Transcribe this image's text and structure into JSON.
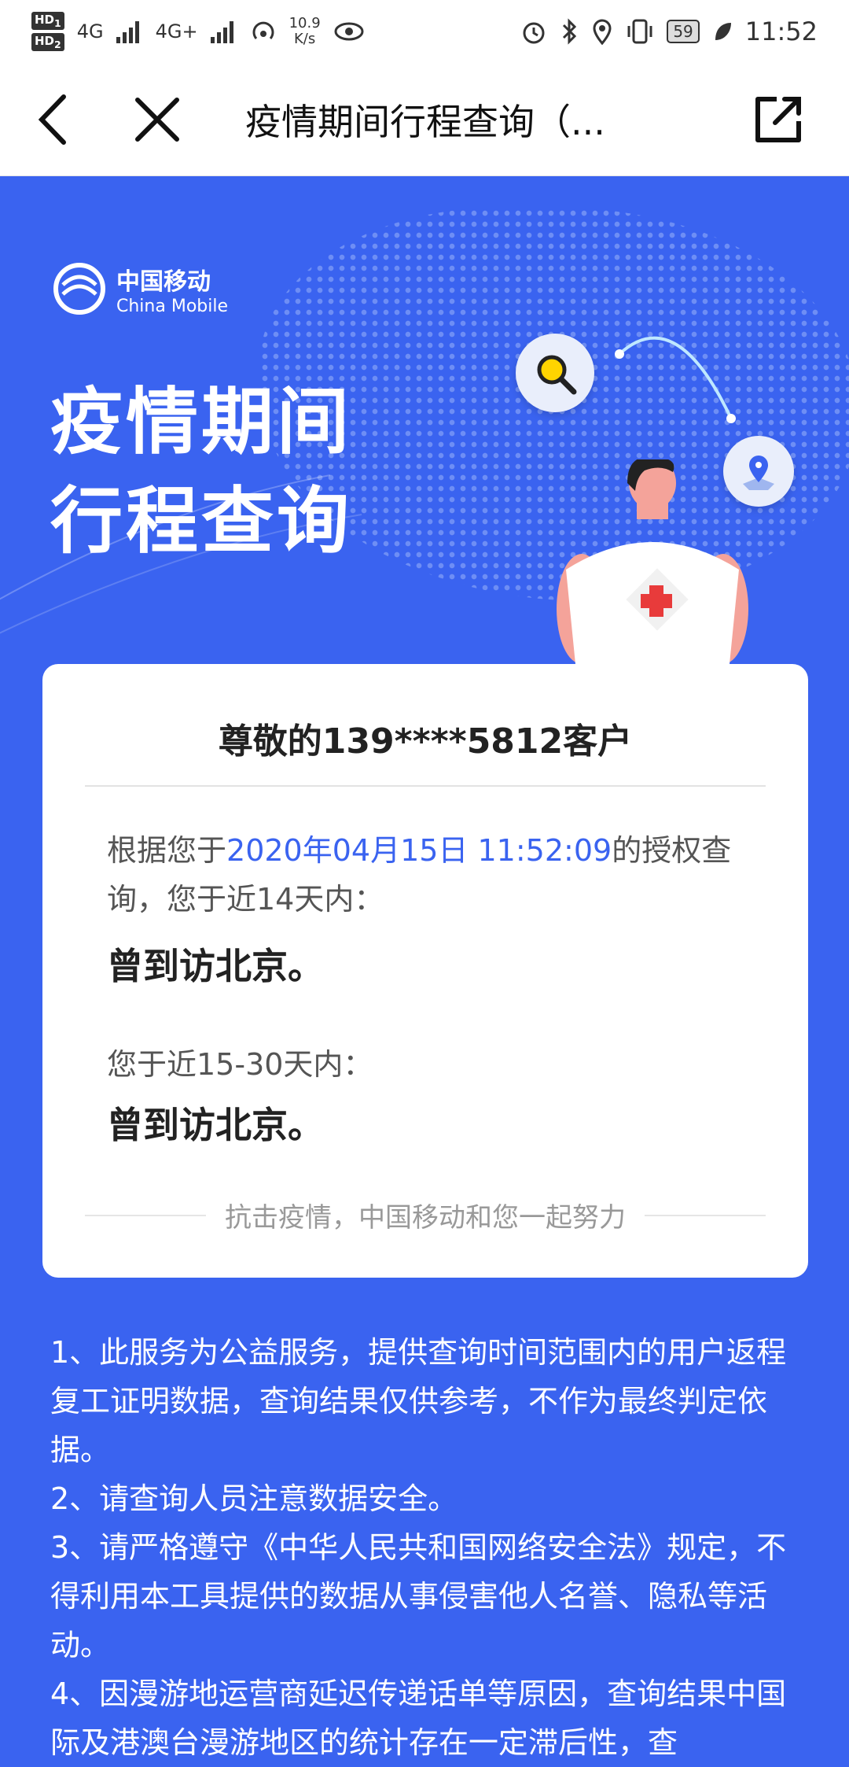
{
  "status_bar": {
    "hd1": "HD",
    "hd2": "HD",
    "sim1": "1",
    "sim2": "2",
    "net1": "4G",
    "net2": "4G+",
    "speed_value": "10.9",
    "speed_unit": "K/s",
    "battery": "59",
    "time": "11:52"
  },
  "nav": {
    "title": "疫情期间行程查询（..."
  },
  "hero": {
    "logo_cn": "中国移动",
    "logo_en": "China Mobile",
    "title_line1": "疫情期间",
    "title_line2": "行程查询"
  },
  "card": {
    "greeting": "尊敬的139****5812客户",
    "intro_prefix": "根据您于",
    "intro_datetime": "2020年04月15日 11:52:09",
    "intro_suffix": "的授权查询，您于近14天内：",
    "result_14": "曾到访北京。",
    "label_30": "您于近15-30天内：",
    "result_30": "曾到访北京。",
    "footer": "抗击疫情，中国移动和您一起努力"
  },
  "notes": [
    "1、此服务为公益服务，提供查询时间范围内的用户返程复工证明数据，查询结果仅供参考，不作为最终判定依据。",
    "2、请查询人员注意数据安全。",
    "3、请严格遵守《中华人民共和国网络安全法》规定，不 得利用本工具提供的数据从事侵害他人名誉、隐私等活动。",
    "4、因漫游地运营商延迟传递话单等原因，查询结果中国际及港澳台漫游地区的统计存在一定滞后性，查"
  ],
  "colors": {
    "accent": "#3a63f0",
    "highlight_text": "#3a63f0"
  },
  "icons": {
    "back": "chevron-left-icon",
    "close": "close-icon",
    "share": "share-external-icon",
    "search": "search-magnifier-icon",
    "location": "location-pin-icon"
  }
}
